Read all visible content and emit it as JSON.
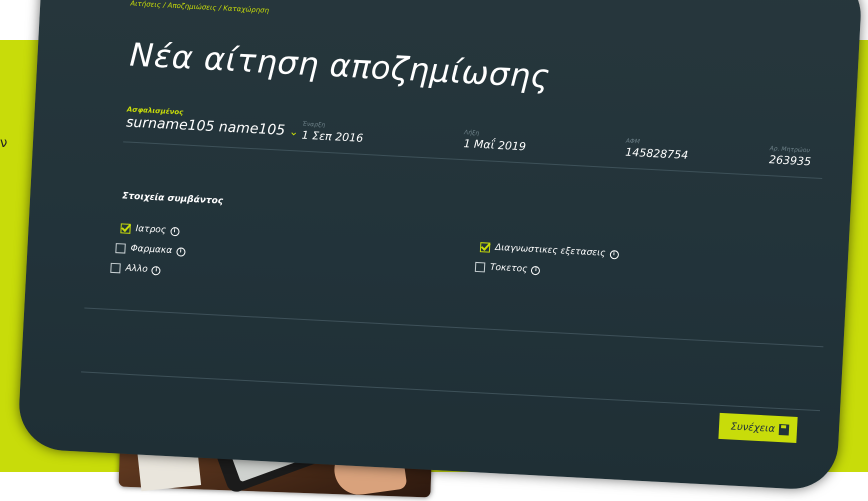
{
  "side_text": "ν",
  "breadcrumb": "Αιτήσεις / Αποζημιώσεις / Καταχώρηση",
  "title": "Νέα αίτηση αποζημίωσης",
  "insured": {
    "label": "Ασφαλισμένος",
    "value": "surname105 name105"
  },
  "fields": [
    {
      "label": "Έναρξη",
      "value": "1 Σεπ 2016"
    },
    {
      "label": "Λήξη",
      "value": "1 Μαΐ 2019"
    },
    {
      "label": "ΑΦΜ",
      "value": "145828754"
    },
    {
      "label": "Αρ. Μητρώου",
      "value": "263935"
    }
  ],
  "section_title": "Στοιχεία συμβάντος",
  "options_left": [
    {
      "label": "Ιατρος",
      "checked": true
    },
    {
      "label": "Φαρμακα",
      "checked": false
    },
    {
      "label": "Αλλο",
      "checked": false
    }
  ],
  "options_right": [
    {
      "label": "Διαγνωστικες εξετασεις",
      "checked": true
    },
    {
      "label": "Τοκετος",
      "checked": false
    }
  ],
  "continue_label": "Συνέχεια",
  "colors": {
    "accent": "#c8dc0a",
    "panel": "#22333a",
    "background_band": "#c8dc0a"
  },
  "icons": {
    "chevron": "chevron-down-icon",
    "info": "info-icon",
    "continue": "save-icon"
  }
}
